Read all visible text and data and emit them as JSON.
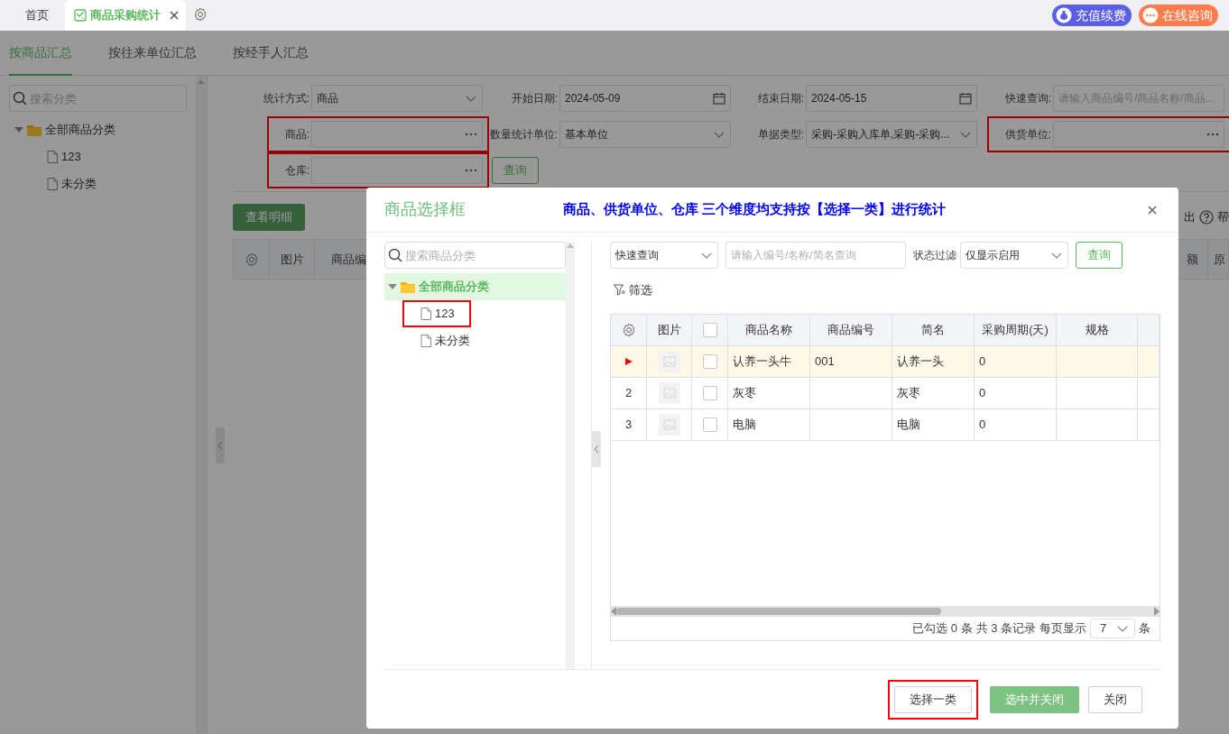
{
  "top_tabs": [
    {
      "label": "首页",
      "selected": false,
      "closable": false
    },
    {
      "label": "商品采购统计",
      "selected": true,
      "closable": true
    }
  ],
  "top_actions": [
    {
      "label": "充值续费",
      "kind": "recharge",
      "color": "#5b5fe6"
    },
    {
      "label": "在线咨询",
      "kind": "chat",
      "color": "#ff7d4d"
    }
  ],
  "report_tabs": [
    {
      "label": "按商品汇总",
      "selected": true
    },
    {
      "label": "按往来单位汇总",
      "selected": false
    },
    {
      "label": "按经手人汇总",
      "selected": false
    }
  ],
  "category_sidebar": {
    "search_placeholder": "搜索分类",
    "tree": [
      {
        "label": "全部商品分类",
        "expanded": true,
        "children": [
          {
            "label": "123"
          },
          {
            "label": "未分类"
          }
        ]
      }
    ]
  },
  "filters": [
    {
      "label": "统计方式:",
      "kind": "select",
      "value": "商品",
      "highlighted": false
    },
    {
      "label": "开始日期:",
      "kind": "date",
      "value": "2024-05-09",
      "highlighted": false
    },
    {
      "label": "结束日期:",
      "kind": "date",
      "value": "2024-05-15",
      "highlighted": false
    },
    {
      "label": "快速查询:",
      "kind": "text",
      "placeholder": "请输入商品编号/商品名称/商品...",
      "highlighted": false
    },
    {
      "label": "商品:",
      "kind": "picker",
      "highlighted": true
    },
    {
      "label": "数量统计单位:",
      "kind": "select",
      "value": "基本单位",
      "highlighted": false
    },
    {
      "label": "单据类型:",
      "kind": "select",
      "value": "采购-采购入库单,采购-采购...",
      "highlighted": false
    },
    {
      "label": "供货单位:",
      "kind": "picker",
      "highlighted": true
    },
    {
      "label": "仓库:",
      "kind": "picker",
      "highlighted": true
    }
  ],
  "query_button": "查询",
  "details_button": "查看明细",
  "export_label": "出",
  "help_label": "帮",
  "report_table": {
    "columns": [
      {
        "kind": "settings"
      },
      {
        "kind": "text",
        "label": "图片"
      },
      {
        "kind": "text",
        "label": "商品编"
      },
      {
        "kind": "text",
        "label": "额"
      },
      {
        "kind": "text",
        "label": "原"
      }
    ]
  },
  "dialog": {
    "title": "商品选择框",
    "note": "商品、供货单位、仓库 三个维度均支持按【选择一类】进行统计",
    "category_search_placeholder": "搜索商品分类",
    "category_tree": [
      {
        "label": "全部商品分类",
        "selected": true,
        "expanded": true,
        "highlighted": false,
        "children": [
          {
            "label": "123",
            "selected": false,
            "highlighted": true
          },
          {
            "label": "未分类",
            "selected": false,
            "highlighted": false
          }
        ]
      }
    ],
    "search_mode": "快速查询",
    "search_placeholder": "请输入编号/名称/简名查询",
    "status_filter_label": "状态过滤",
    "status_filter": "仅显示启用",
    "query_button": "查询",
    "filter_label": "筛选",
    "table": {
      "columns": [
        {
          "kind": "settings"
        },
        {
          "kind": "text",
          "label": "图片"
        },
        {
          "kind": "checkbox",
          "checked": false
        },
        {
          "kind": "text",
          "label": "商品名称"
        },
        {
          "kind": "text",
          "label": "商品编号"
        },
        {
          "kind": "text",
          "label": "简名"
        },
        {
          "kind": "text",
          "label": "采购周期(天)"
        },
        {
          "kind": "text",
          "label": "规格"
        },
        {
          "kind": "blank"
        }
      ],
      "rows": [
        {
          "current": true,
          "checked": false,
          "name": "认养一头牛",
          "code": "001",
          "short_name": "认养一头",
          "purchase_cycle": "0"
        },
        {
          "current": false,
          "row_number": "2",
          "checked": false,
          "name": "灰枣",
          "short_name": "灰枣",
          "purchase_cycle": "0"
        },
        {
          "current": false,
          "row_number": "3",
          "checked": false,
          "name": "电脑",
          "short_name": "电脑",
          "purchase_cycle": "0"
        }
      ]
    },
    "pagination": {
      "selected_text": "已勾选 0 条",
      "total_text": "共 3 条记录",
      "page_size_label": "每页显示",
      "page_size": "7",
      "page_size_unit": "条"
    },
    "buttons": [
      {
        "label": "选择一类",
        "kind": "default",
        "highlighted": true
      },
      {
        "label": "选中并关闭",
        "kind": "primary",
        "highlighted": false
      },
      {
        "label": "关闭",
        "kind": "default",
        "highlighted": false
      }
    ]
  }
}
